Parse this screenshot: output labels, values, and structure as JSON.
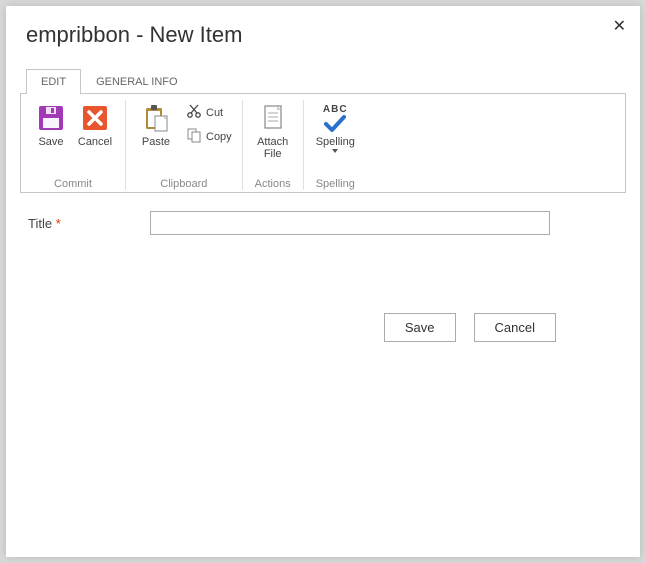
{
  "dialog": {
    "title": "empribbon - New Item"
  },
  "tabs": {
    "edit": "EDIT",
    "general_info": "GENERAL INFO"
  },
  "ribbon": {
    "groups": {
      "commit": {
        "label": "Commit",
        "save": "Save",
        "cancel": "Cancel"
      },
      "clipboard": {
        "label": "Clipboard",
        "paste": "Paste",
        "cut": "Cut",
        "copy": "Copy"
      },
      "actions": {
        "label": "Actions",
        "attach_file": "Attach\nFile"
      },
      "spelling": {
        "label": "Spelling",
        "spelling": "Spelling",
        "abc": "ABC"
      }
    }
  },
  "form": {
    "title_label": "Title",
    "title_value": "",
    "required_marker": "*"
  },
  "buttons": {
    "save": "Save",
    "cancel": "Cancel"
  },
  "colors": {
    "save_icon": "#a23ab8",
    "cancel_icon": "#e8552f",
    "paste_icon_board": "#b08b3e",
    "check_icon": "#2a6fc9"
  }
}
